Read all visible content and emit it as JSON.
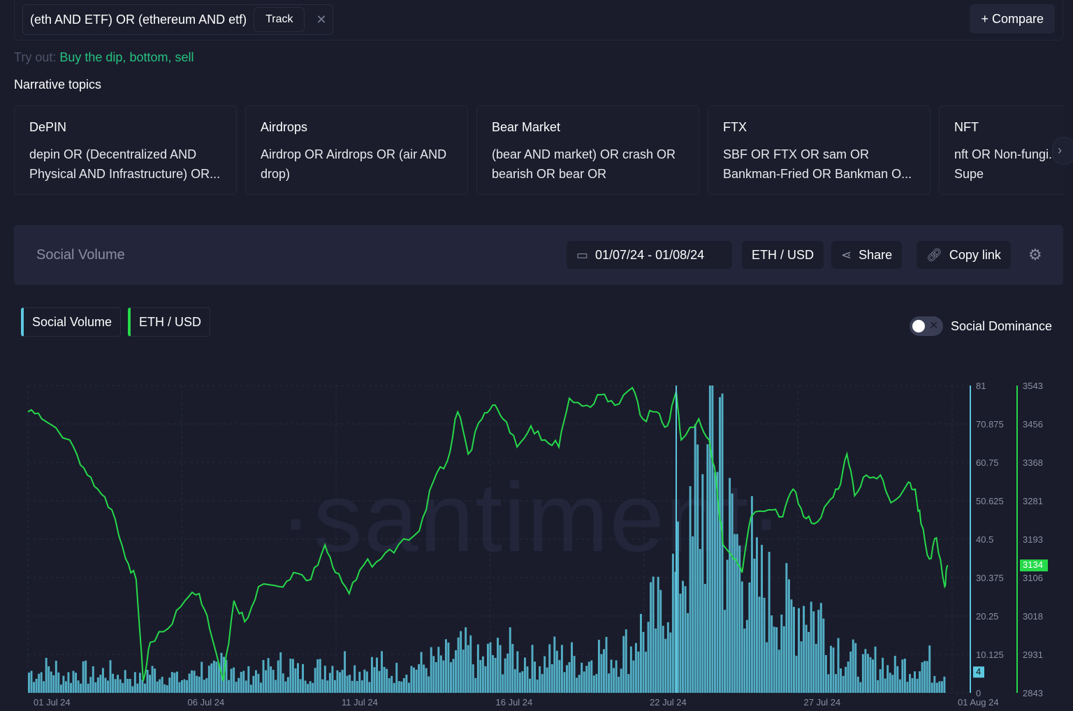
{
  "query": {
    "text": "(eth AND ETF) OR (ethereum AND etf)",
    "track": "Track",
    "compare": "+ Compare"
  },
  "try_out": {
    "label": "Try out:",
    "suggestions": "Buy the dip, bottom, sell"
  },
  "narrative": {
    "title": "Narrative topics",
    "cards": [
      {
        "title": "DePIN",
        "query": "depin OR (Decentralized AND Physical AND Infrastructure) OR..."
      },
      {
        "title": "Airdrops",
        "query": "Airdrop OR Airdrops OR (air AND drop)"
      },
      {
        "title": "Bear Market",
        "query": "(bear AND market) OR crash OR bearish OR bear OR bearmarket..."
      },
      {
        "title": "FTX",
        "query": "SBF OR FTX OR sam OR Bankman-Fried OR Bankman O..."
      },
      {
        "title": "NFT",
        "query": "nft OR Non-fungi... OR rarible OR Supe"
      }
    ]
  },
  "toolbar": {
    "title": "Social Volume",
    "date_range": "01/07/24 - 01/08/24",
    "asset": "ETH / USD",
    "share": "Share",
    "copy_link": "Copy link"
  },
  "legend": {
    "social_volume": "Social Volume",
    "price": "ETH / USD",
    "dominance_label": "Social Dominance",
    "dominance_on": false
  },
  "watermark": "·santiment·",
  "colors": {
    "volume": "#5dc8e0",
    "price": "#26d94a",
    "bg": "#1a1c2b"
  },
  "chart_data": {
    "type": "line+bar",
    "x_ticks": [
      "01 Jul 24",
      "06 Jul 24",
      "11 Jul 24",
      "16 Jul 24",
      "22 Jul 24",
      "27 Jul 24",
      "01 Aug 24"
    ],
    "x_range_days": [
      0,
      30.63
    ],
    "volume_axis": {
      "ticks": [
        "81",
        "70.875",
        "60.75",
        "50.625",
        "40.5",
        "30.375",
        "20.25",
        "10.125",
        "0"
      ],
      "range": [
        0,
        81
      ],
      "last": "4"
    },
    "price_axis": {
      "ticks": [
        "3543",
        "3456",
        "3368",
        "3281",
        "3193",
        "3106",
        "3018",
        "2931",
        "2843"
      ],
      "range": [
        2843,
        3543
      ],
      "last": "3134"
    },
    "price_series": [
      [
        0,
        3483
      ],
      [
        0.45,
        3467
      ],
      [
        1.36,
        3419
      ],
      [
        1.82,
        3355
      ],
      [
        2.27,
        3307
      ],
      [
        2.73,
        3260
      ],
      [
        3.18,
        3148
      ],
      [
        3.52,
        3101
      ],
      [
        3.75,
        2870
      ],
      [
        3.98,
        2958
      ],
      [
        4.55,
        2989
      ],
      [
        5.11,
        3053
      ],
      [
        5.57,
        3069
      ],
      [
        5.91,
        2989
      ],
      [
        6.36,
        2870
      ],
      [
        6.7,
        3053
      ],
      [
        7.05,
        3005
      ],
      [
        7.5,
        3085
      ],
      [
        8.18,
        3085
      ],
      [
        8.64,
        3117
      ],
      [
        9.2,
        3101
      ],
      [
        9.66,
        3180
      ],
      [
        10,
        3117
      ],
      [
        10.45,
        3069
      ],
      [
        10.91,
        3133
      ],
      [
        11.48,
        3148
      ],
      [
        12.05,
        3180
      ],
      [
        12.73,
        3212
      ],
      [
        13.18,
        3323
      ],
      [
        13.64,
        3371
      ],
      [
        13.98,
        3483
      ],
      [
        14.32,
        3387
      ],
      [
        14.77,
        3467
      ],
      [
        15.11,
        3498
      ],
      [
        15.45,
        3467
      ],
      [
        15.91,
        3403
      ],
      [
        16.36,
        3451
      ],
      [
        16.82,
        3419
      ],
      [
        17.27,
        3403
      ],
      [
        17.61,
        3514
      ],
      [
        18.18,
        3498
      ],
      [
        18.64,
        3522
      ],
      [
        19.09,
        3498
      ],
      [
        19.66,
        3538
      ],
      [
        20,
        3467
      ],
      [
        20.45,
        3483
      ],
      [
        20.8,
        3451
      ],
      [
        21.09,
        3530
      ],
      [
        21.25,
        3419
      ],
      [
        21.82,
        3467
      ],
      [
        22.16,
        3419
      ],
      [
        22.39,
        3323
      ],
      [
        22.61,
        3180
      ],
      [
        22.95,
        3148
      ],
      [
        23.23,
        3117
      ],
      [
        23.52,
        3244
      ],
      [
        24.09,
        3260
      ],
      [
        24.55,
        3244
      ],
      [
        24.89,
        3307
      ],
      [
        25.23,
        3244
      ],
      [
        25.57,
        3228
      ],
      [
        26.02,
        3276
      ],
      [
        26.36,
        3307
      ],
      [
        26.64,
        3387
      ],
      [
        26.89,
        3292
      ],
      [
        27.27,
        3339
      ],
      [
        27.73,
        3339
      ],
      [
        28.07,
        3276
      ],
      [
        28.64,
        3323
      ],
      [
        28.86,
        3307
      ],
      [
        29.05,
        3228
      ],
      [
        29.32,
        3148
      ],
      [
        29.55,
        3196
      ],
      [
        29.82,
        3085
      ],
      [
        29.91,
        3134
      ]
    ],
    "volume_series_halfday": [
      6,
      7,
      5,
      6,
      5,
      6,
      5,
      4,
      6,
      5,
      4,
      7,
      6,
      9,
      5,
      6,
      7,
      8,
      6,
      7,
      8,
      9,
      7,
      8,
      6,
      7,
      8,
      9,
      10,
      12,
      9,
      11,
      12,
      10,
      9,
      11,
      10,
      9,
      12,
      11,
      13,
      18,
      22,
      32,
      40,
      58,
      81,
      45,
      38,
      30,
      28,
      24,
      26,
      22,
      14,
      10,
      8,
      9,
      7,
      8,
      9,
      6
    ]
  }
}
